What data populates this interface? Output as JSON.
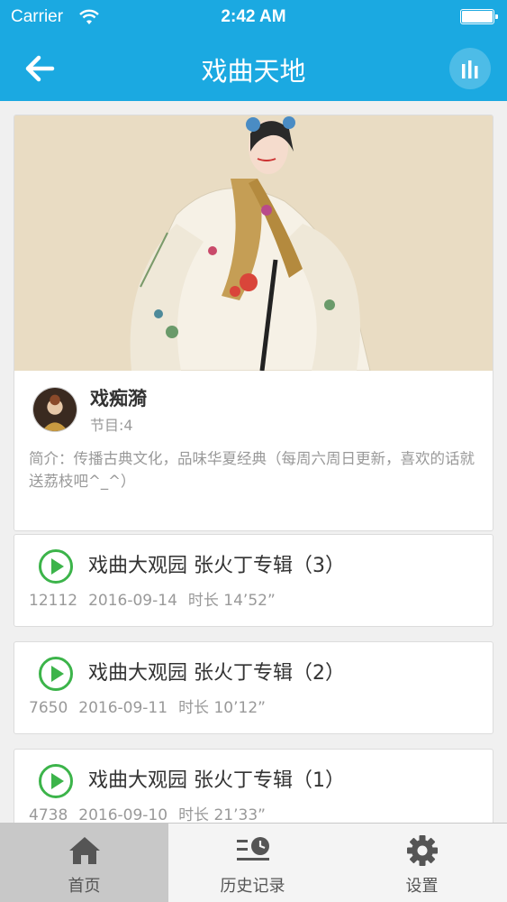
{
  "status_bar": {
    "carrier": "Carrier",
    "time": "2:42 AM",
    "battery_level": 1.0
  },
  "nav": {
    "title": "戏曲天地",
    "back_icon": "arrow-left-icon",
    "now_playing_icon": "equalizer-icon"
  },
  "profile": {
    "name": "戏痴漪",
    "count_label": "节目:4",
    "description": "简介：传播古典文化，品味华夏经典（每周六周日更新，喜欢的话就送荔枝吧^_^）"
  },
  "tracks": [
    {
      "title": "戏曲大观园 张火丁专辑（3）",
      "plays": "12112",
      "date": "2016-09-14",
      "duration": "时长 14’52”"
    },
    {
      "title": "戏曲大观园 张火丁专辑（2）",
      "plays": "7650",
      "date": "2016-09-11",
      "duration": "时长 10’12”"
    },
    {
      "title": "戏曲大观园 张火丁专辑（1）",
      "plays": "4738",
      "date": "2016-09-10",
      "duration": "时长 21’33”"
    }
  ],
  "tabs": [
    {
      "label": "首页",
      "icon": "home-icon",
      "active": true
    },
    {
      "label": "历史记录",
      "icon": "history-icon",
      "active": false
    },
    {
      "label": "设置",
      "icon": "gear-icon",
      "active": false
    }
  ],
  "colors": {
    "accent": "#1ba9e1",
    "play_green": "#3cb44a",
    "tab_active_bg": "#c8c8c8"
  }
}
